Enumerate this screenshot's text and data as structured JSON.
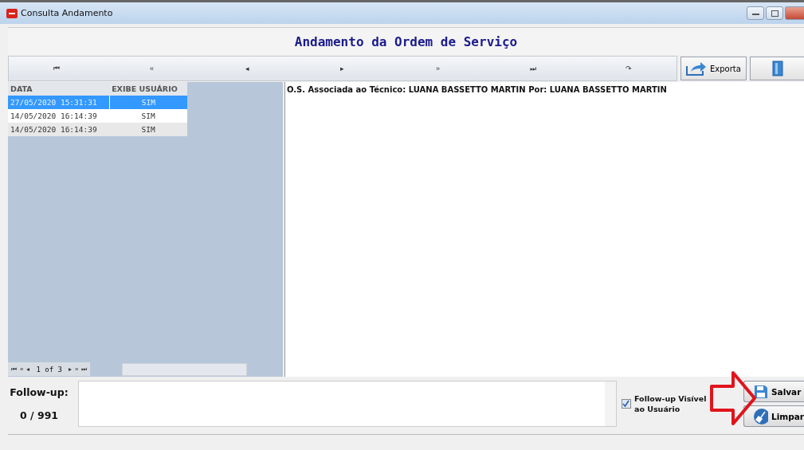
{
  "window": {
    "title": "Consulta Andamento"
  },
  "header": {
    "title": "Andamento da Ordem de Serviço"
  },
  "toolbar": {
    "nav_buttons": [
      "⏮",
      "«",
      "◂",
      "▸",
      "»",
      "⏭",
      "↷"
    ],
    "export_label": "Exporta"
  },
  "grid": {
    "columns": [
      "DATA",
      "EXIBE USUÁRIO"
    ],
    "rows": [
      {
        "data": "27/05/2020 15:31:31",
        "exibe": "SIM",
        "selected": true
      },
      {
        "data": "14/05/2020 16:14:39",
        "exibe": "SIM",
        "selected": false
      },
      {
        "data": "14/05/2020 16:14:39",
        "exibe": "SIM",
        "selected": false
      }
    ],
    "pager": {
      "back_buttons": [
        "⏮",
        "«",
        "◂"
      ],
      "position": "1 of 3",
      "forward_buttons": [
        "▸",
        "»",
        "⏭"
      ]
    }
  },
  "detail": {
    "text": "O.S. Associada ao Técnico: LUANA BASSETTO MARTIN Por: LUANA BASSETTO MARTIN"
  },
  "follow_up": {
    "label": "Follow-up:",
    "counter": "0 / 991",
    "visible_checkbox": {
      "label": "Follow-up Visível ao Usuário",
      "checked": true
    }
  },
  "actions": [
    {
      "kind": "save",
      "label": "Salvar"
    },
    {
      "kind": "clear",
      "label": "Limpar"
    }
  ]
}
